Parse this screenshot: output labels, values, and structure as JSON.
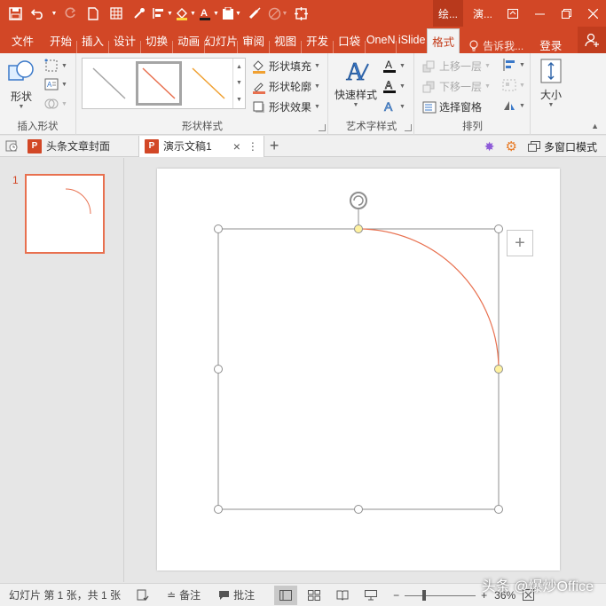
{
  "colors": {
    "accent": "#d24726",
    "arc": "#e8704f",
    "handle_fill": "#fff2a0"
  },
  "quick_access": {
    "icons": [
      "save-icon",
      "undo-icon",
      "redo-icon",
      "new-file-icon",
      "grid-icon",
      "eyedropper-icon",
      "align-icon",
      "fill-icon",
      "font-color-icon",
      "paste-icon",
      "brush-icon",
      "circle-icon",
      "crop-icon"
    ]
  },
  "context_tabs": {
    "drawing": "绘...",
    "doc": "演..."
  },
  "ribbon_tabs": [
    {
      "label": "文件"
    },
    {
      "label": "开始"
    },
    {
      "label": "插入"
    },
    {
      "label": "设计"
    },
    {
      "label": "切换"
    },
    {
      "label": "动画"
    },
    {
      "label": "幻灯片"
    },
    {
      "label": "审阅"
    },
    {
      "label": "视图"
    },
    {
      "label": "开发"
    },
    {
      "label": "口袋"
    },
    {
      "label": "OneN"
    },
    {
      "label": "iSlide"
    },
    {
      "label": "格式"
    }
  ],
  "tell_me": "告诉我...",
  "login": "登录",
  "groups": {
    "insert_shapes": {
      "label": "插入形状",
      "shape_btn": "形状"
    },
    "shape_styles": {
      "label": "形状样式",
      "fill": "形状填充",
      "outline": "形状轮廓",
      "effects": "形状效果"
    },
    "wordart": {
      "label": "艺术字样式",
      "quick_styles": "快速样式"
    },
    "arrange": {
      "label": "排列",
      "bring_forward": "上移一层",
      "send_backward": "下移一层",
      "selection_pane": "选择窗格"
    },
    "size": {
      "label": "大小"
    }
  },
  "doc_tabs": [
    {
      "label": "头条文章封面"
    },
    {
      "label": "演示文稿1"
    }
  ],
  "multi_window": "多窗口模式",
  "thumbnail": {
    "number": "1"
  },
  "status": {
    "slide_info": "幻灯片 第 1 张，共 1 张",
    "notes": "备注",
    "comments": "批注",
    "zoom": "36%"
  },
  "watermark": "头条 @爆炒Office"
}
